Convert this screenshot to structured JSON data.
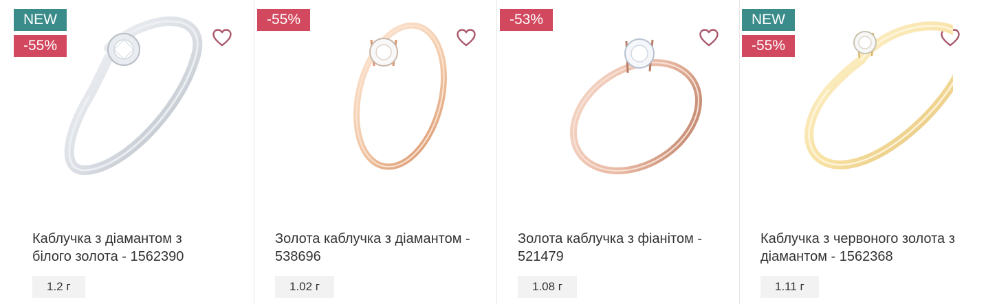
{
  "products": [
    {
      "badges": [
        "NEW",
        "-55%"
      ],
      "title": "Каблучка з діамантом з білого золота - 1562390",
      "weight": "1.2 г",
      "metal_color": "#d9dde3",
      "metal_shade": "#a9b0ba"
    },
    {
      "badges": [
        "-55%"
      ],
      "title": "Золота каблучка з діамантом - 538696",
      "weight": "1.02 г",
      "metal_color": "#f2c9a8",
      "metal_shade": "#d9966e"
    },
    {
      "badges": [
        "-53%"
      ],
      "title": "Золота каблучка з фіанітом - 521479",
      "weight": "1.08 г",
      "metal_color": "#e8b8a2",
      "metal_shade": "#b97c64"
    },
    {
      "badges": [
        "NEW",
        "-55%"
      ],
      "title": "Каблучка з червоного золота з діамантом - 1562368",
      "weight": "1.11 г",
      "metal_color": "#f7e1a3",
      "metal_shade": "#dcb568"
    }
  ],
  "colors": {
    "new_badge": "#3a8c8a",
    "sale_badge": "#d2485e",
    "favorite_icon": "#a8576a"
  },
  "icons": {
    "favorite": "heart-outline-icon"
  }
}
